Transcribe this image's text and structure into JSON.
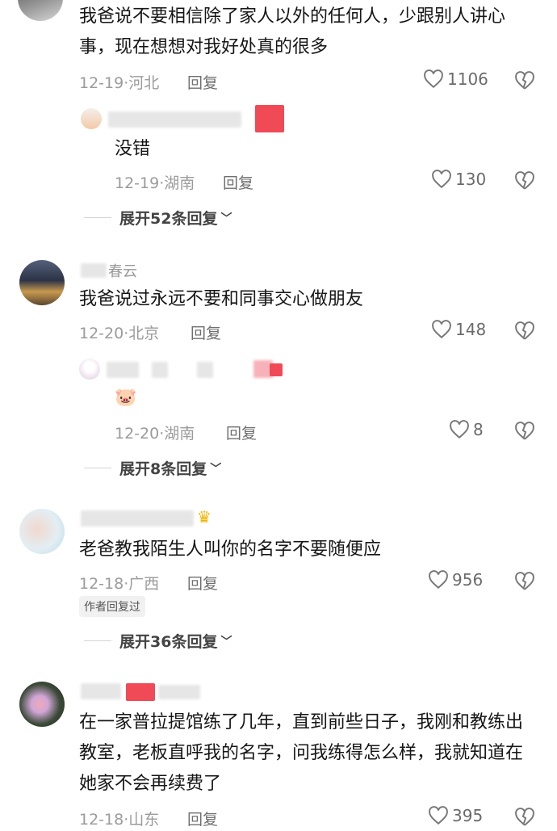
{
  "comments": [
    {
      "text": "我爸说不要相信除了家人以外的任何人，少跟别人讲心事，现在想想对我好处真的很多",
      "date": "12-19",
      "location": "河北",
      "reply_label": "回复",
      "likes": "1106",
      "replies": [
        {
          "text": "没错",
          "date": "12-19",
          "location": "湖南",
          "reply_label": "回复",
          "likes": "130"
        }
      ],
      "expand_label": "展开52条回复"
    },
    {
      "username": "春云",
      "text": "我爸说过永远不要和同事交心做朋友",
      "date": "12-20",
      "location": "北京",
      "reply_label": "回复",
      "likes": "148",
      "replies": [
        {
          "text": "🐷",
          "date": "12-20",
          "location": "湖南",
          "reply_label": "回复",
          "likes": "8"
        }
      ],
      "expand_label": "展开8条回复"
    },
    {
      "text": "老爸教我陌生人叫你的名字不要随便应",
      "date": "12-18",
      "location": "广西",
      "reply_label": "回复",
      "likes": "956",
      "author_tag": "作者回复过",
      "expand_label": "展开36条回复"
    },
    {
      "text": "在一家普拉提馆练了几年，直到前些日子，我刚和教练出教室，老板直呼我的名字，问我练得怎么样，我就知道在她家不会再续费了",
      "date": "12-18",
      "location": "山东",
      "reply_label": "回复",
      "likes": "395"
    }
  ],
  "colors": {
    "accent_red": "#f04a57",
    "meta_gray": "#9b9b9b"
  },
  "icons": {
    "like": "heart-outline-icon",
    "dislike": "broken-heart-icon",
    "expand": "chevron-down-icon"
  }
}
